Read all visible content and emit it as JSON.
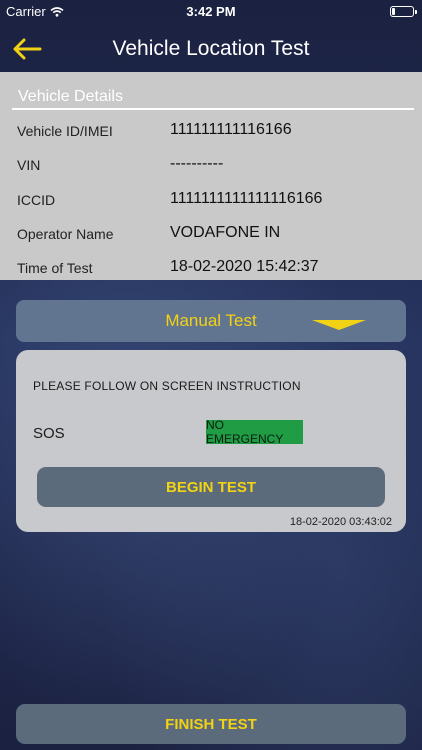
{
  "status_bar": {
    "carrier": "Carrier",
    "time": "3:42 PM"
  },
  "header": {
    "title": "Vehicle Location Test",
    "back_icon": "back-arrow-icon",
    "accent_color": "#f2d214"
  },
  "vehicle_details": {
    "heading": "Vehicle Details",
    "rows": [
      {
        "label": "Vehicle ID/IMEI",
        "value": "111111111116166"
      },
      {
        "label": "VIN",
        "value": "----------"
      },
      {
        "label": "ICCID",
        "value": "1111111111111116166"
      },
      {
        "label": "Operator Name",
        "value": "VODAFONE IN"
      },
      {
        "label": "Time of Test",
        "value": "18-02-2020 15:42:37"
      }
    ]
  },
  "test_selector": {
    "label": "Manual Test",
    "icon": "chevron-down-icon"
  },
  "test_card": {
    "instruction": "PLEASE FOLLOW ON SCREEN INSTRUCTION",
    "sos_label": "SOS",
    "sos_status": "NO EMERGENCY",
    "sos_status_color": "#1f9c44",
    "begin_label": "BEGIN TEST",
    "timestamp": "18-02-2020 03:43:02"
  },
  "finish_label": "FINISH TEST"
}
